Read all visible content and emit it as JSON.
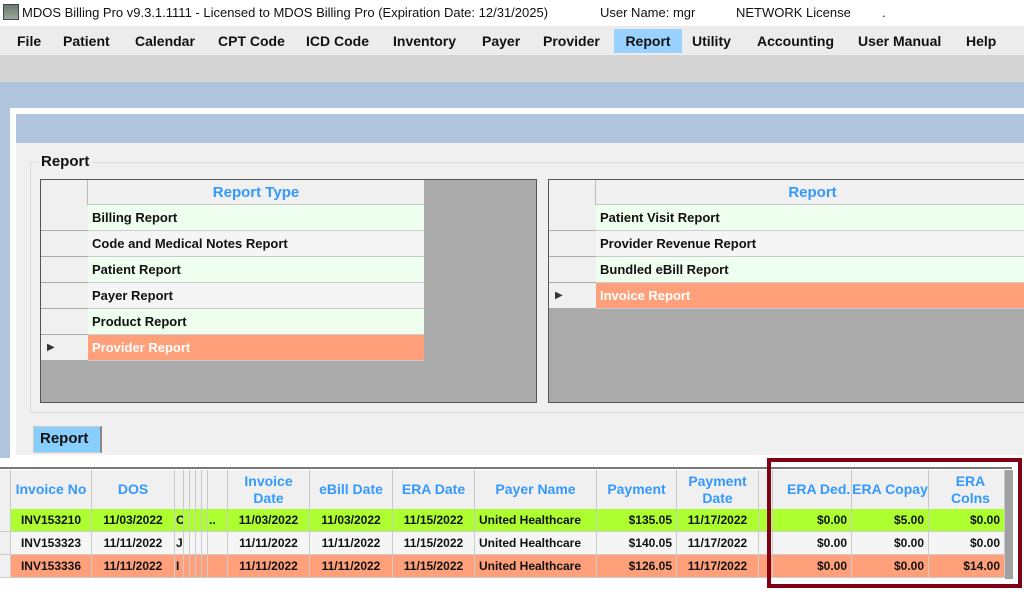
{
  "titlebar": {
    "title": "MDOS Billing Pro v9.3.1.1111 - Licensed to MDOS Billing Pro (Expiration Date: 12/31/2025)",
    "user": "User Name: mgr",
    "license": "NETWORK License",
    "dot": "."
  },
  "menu": [
    "File",
    "Patient",
    "Calendar",
    "CPT Code",
    "ICD Code",
    "Inventory",
    "Payer",
    "Provider",
    "Report",
    "Utility",
    "Accounting",
    "User Manual",
    "Help"
  ],
  "active_menu": "Report",
  "group_label": "Report",
  "report_types": {
    "header": "Report Type",
    "items": [
      "Billing Report",
      "Code and Medical Notes Report",
      "Patient Report",
      "Payer Report",
      "Product Report",
      "Provider Report"
    ],
    "selected": "Provider Report"
  },
  "reports": {
    "header": "Report",
    "items": [
      "Patient Visit Report",
      "Provider Revenue Report",
      "Bundled eBill Report",
      "Invoice Report"
    ],
    "selected": "Invoice Report"
  },
  "report_button": "Report",
  "table": {
    "headers": {
      "invoice_no": "Invoice No",
      "dos": "DOS",
      "invoice_date": "Invoice Date",
      "ebill_date": "eBill Date",
      "era_date": "ERA Date",
      "payer_name": "Payer Name",
      "payment": "Payment",
      "payment_date": "Payment Date",
      "era_ded": "ERA Ded.",
      "era_copay": "ERA Copay",
      "era_colns": "ERA Colns"
    },
    "rows": [
      {
        "invoice_no": "INV153210",
        "dos": "11/03/2022",
        "trunc": "C",
        "trunc2": "..",
        "invoice_date": "11/03/2022",
        "ebill_date": "11/03/2022",
        "era_date": "11/15/2022",
        "payer_name": "United Healthcare",
        "payment": "$135.05",
        "payment_date": "11/17/2022",
        "era_ded": "$0.00",
        "era_copay": "$5.00",
        "era_colns": "$0.00",
        "color": "#adff2f"
      },
      {
        "invoice_no": "INV153323",
        "dos": "11/11/2022",
        "trunc": "J",
        "trunc2": "",
        "invoice_date": "11/11/2022",
        "ebill_date": "11/11/2022",
        "era_date": "11/15/2022",
        "payer_name": "United Healthcare",
        "payment": "$140.05",
        "payment_date": "11/17/2022",
        "era_ded": "$0.00",
        "era_copay": "$0.00",
        "era_colns": "$0.00",
        "color": "#f5f5f5"
      },
      {
        "invoice_no": "INV153336",
        "dos": "11/11/2022",
        "trunc": "I",
        "trunc2": "",
        "invoice_date": "11/11/2022",
        "ebill_date": "11/11/2022",
        "era_date": "11/15/2022",
        "payer_name": "United Healthcare",
        "payment": "$126.05",
        "payment_date": "11/17/2022",
        "era_ded": "$0.00",
        "era_copay": "$0.00",
        "era_colns": "$14.00",
        "color": "#ffa07a"
      }
    ]
  },
  "colors": {
    "highlight_box": "#800014",
    "menu_active": "#99d1ff",
    "header_text": "#3399ff",
    "selected_row": "#ffa07a",
    "paid_row": "#adff2f"
  }
}
